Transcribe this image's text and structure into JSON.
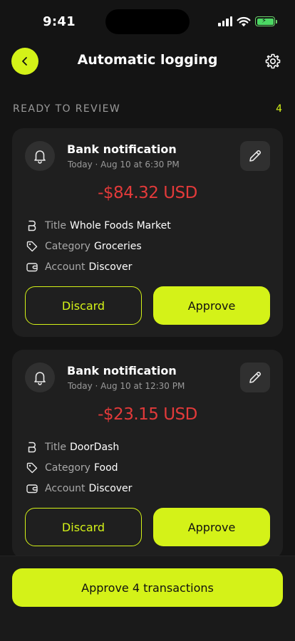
{
  "status_bar": {
    "time": "9:41",
    "icons": [
      "cellular-signal-icon",
      "wifi-icon",
      "battery-charging-icon"
    ]
  },
  "header": {
    "title": "Automatic logging",
    "back_icon": "chevron-left-icon",
    "settings_icon": "gear-icon"
  },
  "section": {
    "label": "READY TO REVIEW",
    "count": "4"
  },
  "cards": [
    {
      "source": "Bank notification",
      "timestamp": "Today · Aug 10 at 6:30 PM",
      "amount": "-$84.32 USD",
      "title_label": "Title",
      "title_value": "Whole Foods Market",
      "category_label": "Category",
      "category_value": "Groceries",
      "account_label": "Account",
      "account_value": "Discover",
      "discard_label": "Discard",
      "approve_label": "Approve"
    },
    {
      "source": "Bank notification",
      "timestamp": "Today · Aug 10 at 12:30 PM",
      "amount": "-$23.15 USD",
      "title_label": "Title",
      "title_value": "DoorDash",
      "category_label": "Category",
      "category_value": "Food",
      "account_label": "Account",
      "account_value": "Discover",
      "discard_label": "Discard",
      "approve_label": "Approve"
    }
  ],
  "footer": {
    "approve_all_label": "Approve 4 transactions"
  },
  "colors": {
    "accent": "#d4f218",
    "background": "#141414",
    "card": "#1f1f1f",
    "negative_amount": "#e23a3a",
    "muted_text": "#9a9a9a"
  }
}
